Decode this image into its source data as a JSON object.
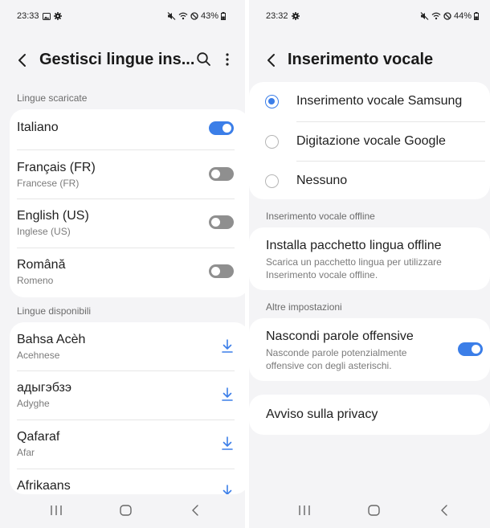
{
  "left": {
    "status": {
      "time": "23:33",
      "battery": "43%"
    },
    "header": {
      "title": "Gestisci lingue ins..."
    },
    "downloaded_label": "Lingue scaricate",
    "downloaded": [
      {
        "name": "Italiano",
        "sub": "",
        "enabled": true
      },
      {
        "name": "Français (FR)",
        "sub": "Francese (FR)",
        "enabled": false
      },
      {
        "name": "English (US)",
        "sub": "Inglese (US)",
        "enabled": false
      },
      {
        "name": "Română",
        "sub": "Romeno",
        "enabled": false
      }
    ],
    "available_label": "Lingue disponibili",
    "available": [
      {
        "name": "Bahsa Acèh",
        "sub": "Acehnese"
      },
      {
        "name": "адыгэбзэ",
        "sub": "Adyghe"
      },
      {
        "name": "Qafaraf",
        "sub": "Afar"
      },
      {
        "name": "Afrikaans",
        "sub": ""
      }
    ]
  },
  "right": {
    "status": {
      "time": "23:32",
      "battery": "44%"
    },
    "header": {
      "title": "Inserimento vocale"
    },
    "options": [
      {
        "label": "Inserimento vocale Samsung",
        "selected": true
      },
      {
        "label": "Digitazione vocale Google",
        "selected": false
      },
      {
        "label": "Nessuno",
        "selected": false
      }
    ],
    "offline_section": "Inserimento vocale offline",
    "offline_item": {
      "title": "Installa pacchetto lingua offline",
      "desc": "Scarica un pacchetto lingua per utilizzare Inserimento vocale offline."
    },
    "other_section": "Altre impostazioni",
    "offensive_item": {
      "title": "Nascondi parole offensive",
      "desc": "Nasconde parole potenzialmente offensive con degli asterischi.",
      "enabled": true
    },
    "privacy_item": {
      "title": "Avviso sulla privacy"
    }
  },
  "colors": {
    "accent": "#3b7ee8",
    "background": "#f4f4f6",
    "card": "#ffffff",
    "toggle_off": "#8f8f8f"
  }
}
